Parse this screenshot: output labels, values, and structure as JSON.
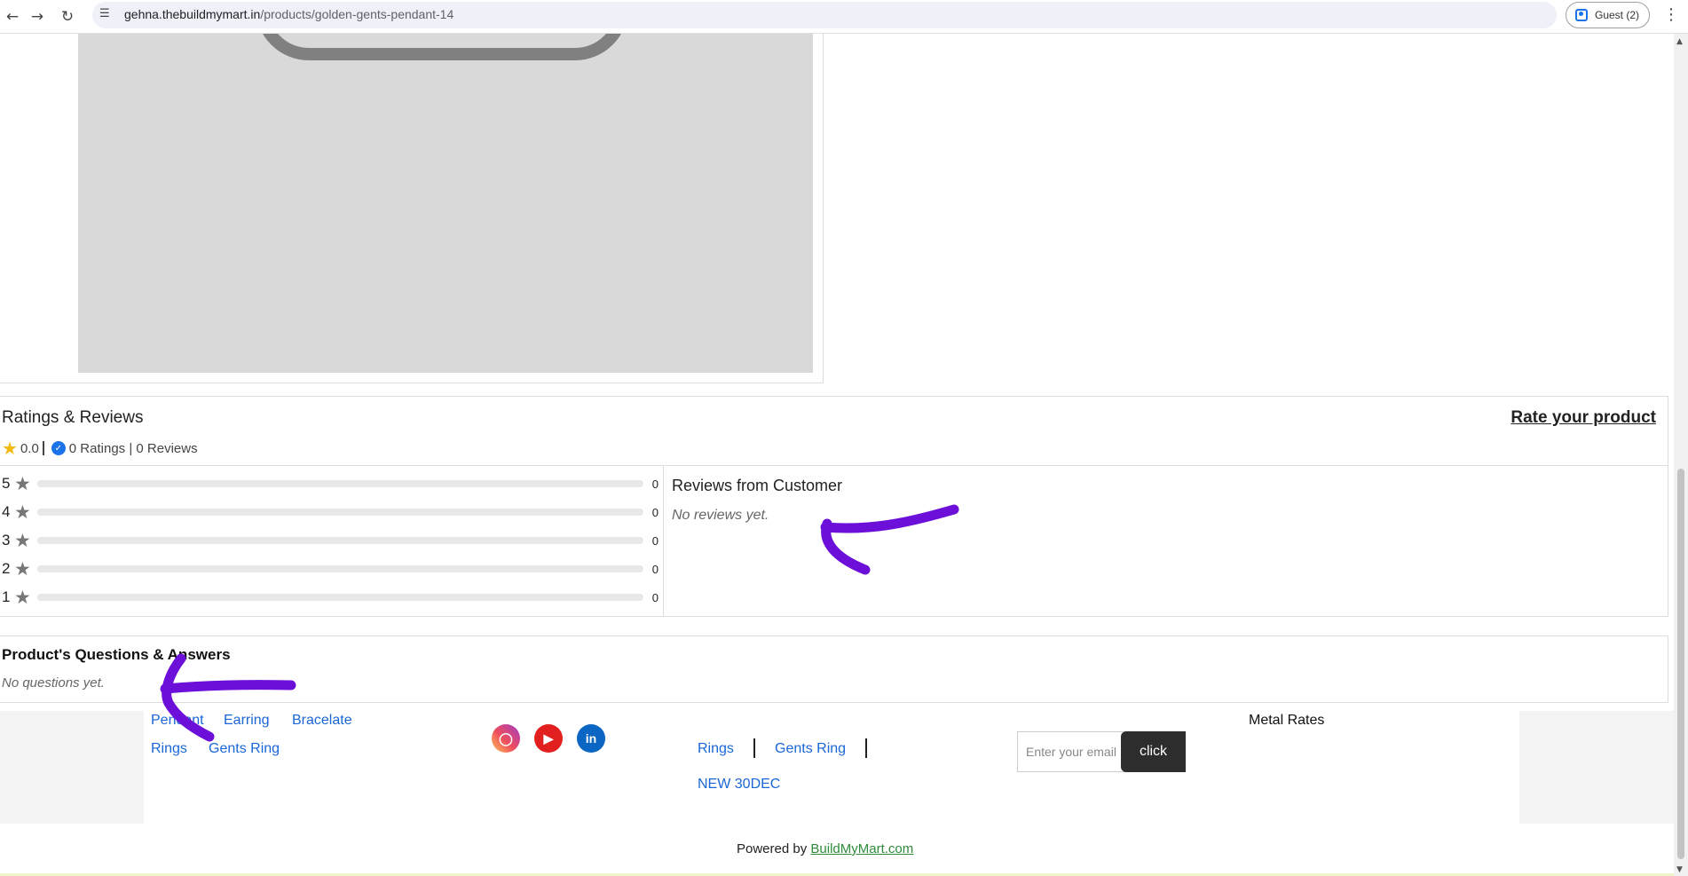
{
  "browser": {
    "url_domain": "gehna.thebuildmymart.in",
    "url_path": "/products/golden-gents-pendant-14",
    "profile_label": "Guest (2)",
    "icons": [
      "back-arrow-icon",
      "forward-arrow-icon",
      "reload-icon",
      "site-settings-icon",
      "profile-icon",
      "kebab-menu-icon"
    ]
  },
  "ratings": {
    "title": "Ratings & Reviews",
    "rate_link": "Rate your product",
    "average": "0.0",
    "summary": "0 Ratings | 0 Reviews",
    "bars": [
      {
        "stars": "5",
        "count": "0",
        "fraction": 0
      },
      {
        "stars": "4",
        "count": "0",
        "fraction": 0
      },
      {
        "stars": "3",
        "count": "0",
        "fraction": 0
      },
      {
        "stars": "2",
        "count": "0",
        "fraction": 0
      },
      {
        "stars": "1",
        "count": "0",
        "fraction": 0
      }
    ],
    "reviews_title": "Reviews from Customer",
    "reviews_empty": "No reviews yet."
  },
  "qa": {
    "title": "Product's Questions & Answers",
    "empty": "No questions yet."
  },
  "footer": {
    "categories_row1": [
      "Pendant",
      "Earring",
      "Bracelate"
    ],
    "categories_row2": [
      "Rings",
      "Gents Ring"
    ],
    "social": [
      "instagram-icon",
      "youtube-icon",
      "linkedin-icon"
    ],
    "menu_links": [
      "Rings",
      "Gents Ring",
      "NEW 30DEC"
    ],
    "email_placeholder": "Enter your email",
    "email_button": "click",
    "metal_rates": "Metal Rates",
    "powered_prefix": "Powered by",
    "powered_link": "BuildMyMart.com"
  },
  "colors": {
    "link": "#1a66d6",
    "annotation_arrow": "#6b0fd9",
    "button_dark": "#2d2d2d",
    "powered_link": "#2e8b3a"
  }
}
